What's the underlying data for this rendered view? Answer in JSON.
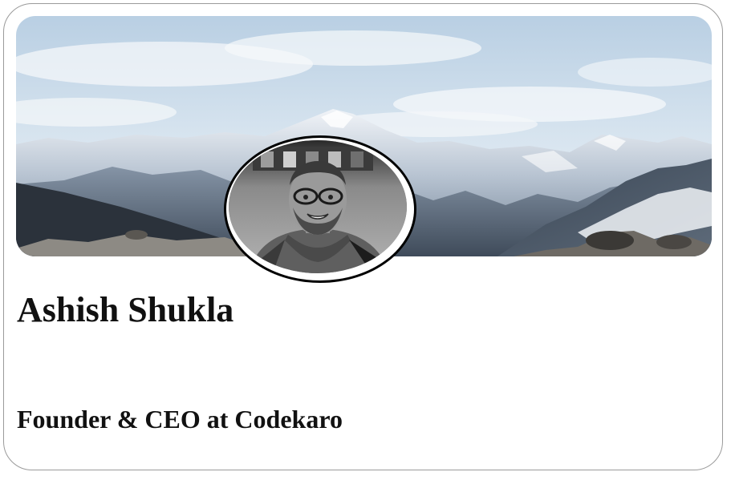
{
  "profile": {
    "name": "Ashish Shukla",
    "headline": "Founder & CEO at Codekaro"
  },
  "cover_image": {
    "depicts": "mountain-range-icon"
  },
  "avatar_image": {
    "depicts": "person-portrait-icon"
  },
  "colors": {
    "text": "#111111",
    "card_border": "#9a9a9a",
    "avatar_border": "#000000",
    "sky": "#c9dbe9",
    "snow": "#e9eef4",
    "rock": "#4c5866"
  }
}
